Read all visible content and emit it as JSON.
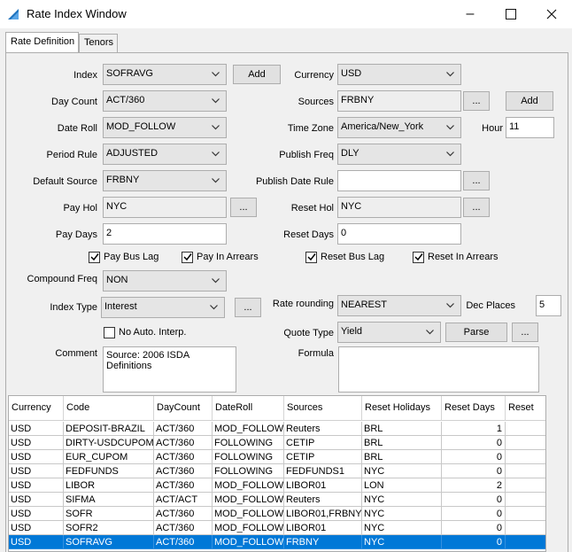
{
  "window": {
    "title": "Rate Index Window",
    "minimize": "–",
    "maximize": "☐",
    "close": "✕"
  },
  "tabs": [
    {
      "label": "Rate Definition"
    },
    {
      "label": "Tenors"
    }
  ],
  "form": {
    "index": {
      "label": "Index",
      "value": "SOFRAVG"
    },
    "index_add": "Add",
    "currency": {
      "label": "Currency",
      "value": "USD"
    },
    "day_count": {
      "label": "Day Count",
      "value": "ACT/360"
    },
    "sources": {
      "label": "Sources",
      "value": "FRBNY"
    },
    "sources_browse": "...",
    "sources_add": "Add",
    "date_roll": {
      "label": "Date Roll",
      "value": "MOD_FOLLOW"
    },
    "time_zone": {
      "label": "Time Zone",
      "value": "America/New_York"
    },
    "hour": {
      "label": "Hour",
      "value": "11"
    },
    "period_rule": {
      "label": "Period Rule",
      "value": "ADJUSTED"
    },
    "publish_freq": {
      "label": "Publish Freq",
      "value": "DLY"
    },
    "default_source": {
      "label": "Default Source",
      "value": "FRBNY"
    },
    "publish_date_rule": {
      "label": "Publish Date Rule",
      "value": ""
    },
    "publish_date_rule_browse": "...",
    "pay_hol": {
      "label": "Pay Hol",
      "value": "NYC"
    },
    "pay_hol_browse": "...",
    "reset_hol": {
      "label": "Reset Hol",
      "value": "NYC"
    },
    "reset_hol_browse": "...",
    "pay_days": {
      "label": "Pay Days",
      "value": "2"
    },
    "reset_days": {
      "label": "Reset Days",
      "value": "0"
    },
    "pay_bus_lag": {
      "label": "Pay Bus Lag",
      "checked": true
    },
    "pay_in_arrears": {
      "label": "Pay In Arrears",
      "checked": true
    },
    "reset_bus_lag": {
      "label": "Reset Bus Lag",
      "checked": true
    },
    "reset_in_arrears": {
      "label": "Reset In Arrears",
      "checked": true
    },
    "compound_freq": {
      "label": "Compound Freq",
      "value": "NON"
    },
    "index_type": {
      "label": "Index Type",
      "value": "Interest"
    },
    "index_type_browse": "...",
    "rate_rounding": {
      "label": "Rate rounding",
      "value": "NEAREST"
    },
    "dec_places": {
      "label": "Dec Places",
      "value": "5"
    },
    "no_auto_interp": {
      "label": "No Auto. Interp.",
      "checked": false
    },
    "quote_type": {
      "label": "Quote Type",
      "value": "Yield"
    },
    "parse": "Parse",
    "quote_type_browse": "...",
    "comment": {
      "label": "Comment",
      "value": "Source: 2006 ISDA Definitions"
    },
    "formula": {
      "label": "Formula",
      "value": ""
    }
  },
  "grid": {
    "headers": [
      "Currency",
      "Code",
      "DayCount",
      "DateRoll",
      "Sources",
      "Reset Holidays",
      "Reset Days",
      "Reset"
    ],
    "rows": [
      [
        "USD",
        "DEPOSIT-BRAZIL",
        "ACT/360",
        "MOD_FOLLOW",
        "Reuters",
        "BRL",
        "1"
      ],
      [
        "USD",
        "DIRTY-USDCUPOM",
        "ACT/360",
        "FOLLOWING",
        "CETIP",
        "BRL",
        "0"
      ],
      [
        "USD",
        "EUR_CUPOM",
        "ACT/360",
        "FOLLOWING",
        "CETIP",
        "BRL",
        "0"
      ],
      [
        "USD",
        "FEDFUNDS",
        "ACT/360",
        "FOLLOWING",
        "FEDFUNDS1",
        "NYC",
        "0"
      ],
      [
        "USD",
        "LIBOR",
        "ACT/360",
        "MOD_FOLLOW",
        "LIBOR01",
        "LON",
        "2"
      ],
      [
        "USD",
        "SIFMA",
        "ACT/ACT",
        "MOD_FOLLOW",
        "Reuters",
        "NYC",
        "0"
      ],
      [
        "USD",
        "SOFR",
        "ACT/360",
        "MOD_FOLLOW",
        "LIBOR01,FRBNY",
        "NYC",
        "0"
      ],
      [
        "USD",
        "SOFR2",
        "ACT/360",
        "MOD_FOLLOW",
        "LIBOR01",
        "NYC",
        "0"
      ],
      [
        "USD",
        "SOFRAVG",
        "ACT/360",
        "MOD_FOLLOW",
        "FRBNY",
        "NYC",
        "0"
      ]
    ],
    "selected_index": 8
  },
  "colors": {
    "selection": "#0078d7",
    "background": "#f0f0f0",
    "titlebar": "#ffffff"
  },
  "icons": {
    "app": "blue-triangle-icon",
    "dropdown": "chevron-down-icon"
  }
}
